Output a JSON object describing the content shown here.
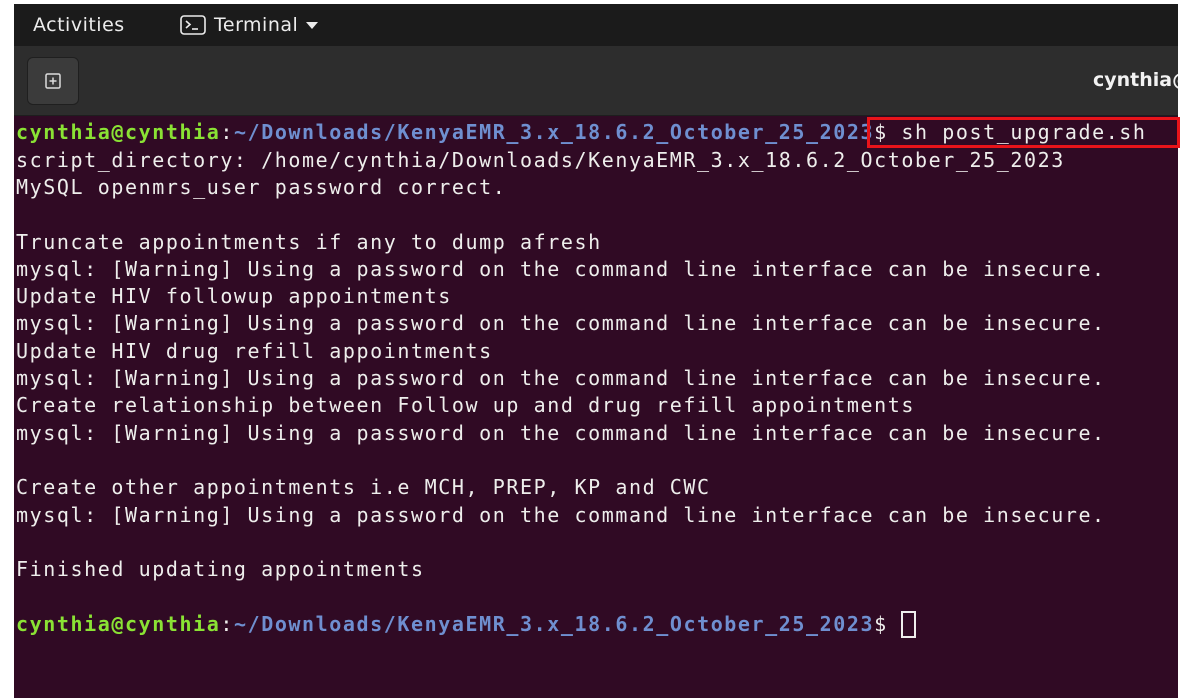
{
  "top_bar": {
    "activities_label": "Activities",
    "app_menu": {
      "label": "Terminal",
      "icon": "terminal-icon",
      "dropdown_icon": "caret-down-icon"
    }
  },
  "window": {
    "title": "cynthia@",
    "new_tab_icon": "new-tab-icon"
  },
  "terminal": {
    "prompt": {
      "user_host": "cynthia@cynthia",
      "separator": ":",
      "path": "~/Downloads/KenyaEMR_3.x_18.6.2_October_25_2023",
      "symbol": "$"
    },
    "command": "sh post_upgrade.sh",
    "output": [
      "script_directory: /home/cynthia/Downloads/KenyaEMR_3.x_18.6.2_October_25_2023",
      "MySQL openmrs_user password correct.",
      "Truncate appointments if any to dump afresh",
      "mysql: [Warning] Using a password on the command line interface can be insecure.",
      "Update HIV followup appointments",
      "mysql: [Warning] Using a password on the command line interface can be insecure.",
      "Update HIV drug refill appointments",
      "mysql: [Warning] Using a password on the command line interface can be insecure.",
      "Create relationship between Follow up and drug refill appointments",
      "mysql: [Warning] Using a password on the command line interface can be insecure.",
      "Create other appointments i.e MCH, PREP, KP and CWC",
      "mysql: [Warning] Using a password on the command line interface can be insecure.",
      "Finished updating appointments"
    ]
  },
  "colors": {
    "terminal_background": "#300a24",
    "prompt_user_host": "#8ae234",
    "prompt_path": "#6f8fd0",
    "terminal_text": "#eeeeec",
    "highlight_box": "#e8141a",
    "top_bar_background": "#1b1b1b",
    "header_bar_background": "#2d2d2d"
  }
}
